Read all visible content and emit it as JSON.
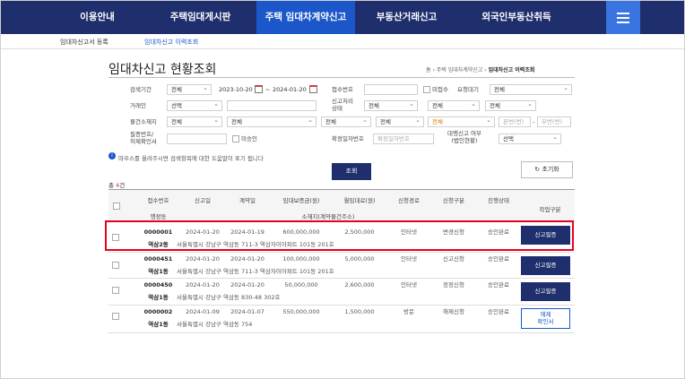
{
  "nav": {
    "items": [
      {
        "label": "이용안내"
      },
      {
        "label": "주택임대게시판"
      },
      {
        "label": "주택 임대차계약신고"
      },
      {
        "label": "부동산거래신고"
      },
      {
        "label": "외국인부동산취득"
      }
    ],
    "active_index": 2,
    "colors": {
      "bar": "#1f2f6e",
      "active": "#1b57c9",
      "menu_button": "#3a74e0"
    }
  },
  "subnav": {
    "items": [
      {
        "label": "임대차신고서 등록"
      },
      {
        "label": "임대차신고 이력조회"
      }
    ]
  },
  "page": {
    "title": "임대차신고 현황조회",
    "breadcrumb": [
      "홈",
      "주택 임대차계약신고",
      "임대차신고 이력조회"
    ]
  },
  "form": {
    "labels": {
      "period": "검색기간",
      "receipt_no": "접수번호",
      "trade_type": "거래인",
      "status": "신고처리\n상태",
      "property": "물건소재지",
      "confirm": "필증번호/\n허제확인서",
      "fixed_date": "확정일자번호",
      "target": "대행신고 여부\n(법인현황)",
      "unreceived": "미접수",
      "pending": "요청대기",
      "unapproved": "미승인"
    },
    "values": {
      "period_type": "전체",
      "date_from": "2023-10-20",
      "date_sep": "~",
      "date_to": "2024-01-20",
      "pending_select": "전체",
      "trade_select": "선택",
      "status_select": "전체",
      "status_select2": "전체",
      "status_select3": "전체",
      "addr_sido": "전체",
      "addr_sigungu": "전체",
      "addr_dong": "전체",
      "addr_ri": "전체",
      "addr_bunji": "전체",
      "target_select": "선택"
    },
    "placeholders": {
      "main_no": "본번(번)",
      "sub_no": "부번(번)",
      "fixed_date": "확정일자번호"
    },
    "info": "마우스를 올려주시면 검색항목에 대한 도움말이 표기 됩니다",
    "search_button": "조회",
    "reset_button": "초기화"
  },
  "table": {
    "count_prefix": "총 ",
    "count": "4",
    "count_suffix": "건",
    "headers": {
      "receipt_no": "접수번호",
      "report_date": "신고일",
      "contract_date": "계약일",
      "deposit": "임대보증금(원)",
      "rent": "월임대료(원)",
      "channel": "신청경로",
      "report_type": "신청구분",
      "status": "진행상태",
      "action": "작업구분",
      "dong": "행정동",
      "address": "소재지(계약물건주소)"
    },
    "rows": [
      {
        "receipt_no": "0000001",
        "report_date": "2024-01-20",
        "contract_date": "2024-01-19",
        "deposit": "600,000,000",
        "rent": "2,500,000",
        "channel": "인터넷",
        "report_type": "변경신청",
        "status": "승인완료",
        "dong": "역삼2동",
        "address": "서울특별시 강남구 역삼동 711-3 역삼자이아파트 101동 201호",
        "action": "신고필증"
      },
      {
        "receipt_no": "0000451",
        "report_date": "2024-01-20",
        "contract_date": "2024-01-20",
        "deposit": "100,000,000",
        "rent": "5,000,000",
        "channel": "인터넷",
        "report_type": "신고신청",
        "status": "승인완료",
        "dong": "역삼1동",
        "address": "서울특별시 강남구 역삼동 711-3 역삼자이아파트 101동 201호",
        "action": "신고필증"
      },
      {
        "receipt_no": "0000450",
        "report_date": "2024-01-20",
        "contract_date": "2024-01-20",
        "deposit": "50,000,000",
        "rent": "2,600,000",
        "channel": "인터넷",
        "report_type": "정정신청",
        "status": "승인완료",
        "dong": "역삼1동",
        "address": "서울특별시 강남구 역삼동 830-48 302호",
        "action": "신고필증"
      },
      {
        "receipt_no": "0000002",
        "report_date": "2024-01-09",
        "contract_date": "2024-01-07",
        "deposit": "550,000,000",
        "rent": "1,500,000",
        "channel": "방문",
        "report_type": "해제신청",
        "status": "승인완료",
        "dong": "역삼1동",
        "address": "서울특별시 강남구 역삼동 754",
        "action": "해제\n확인서"
      }
    ]
  }
}
